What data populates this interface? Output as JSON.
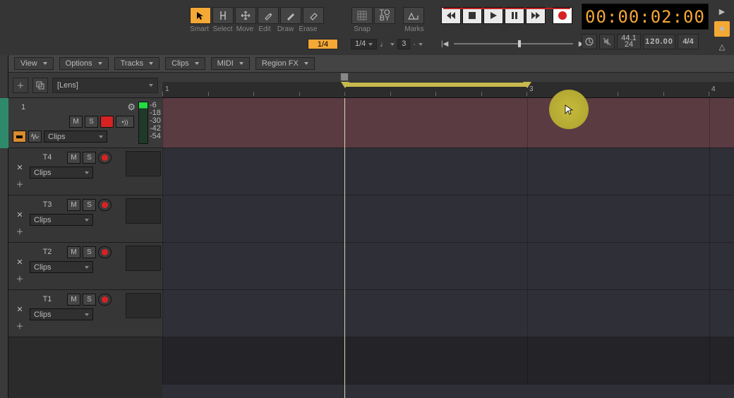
{
  "toolbar": {
    "tools": [
      "Smart",
      "Select",
      "Move",
      "Edit",
      "Draw",
      "Erase"
    ],
    "snap_label": "Snap",
    "marks_label": "Marks",
    "duration": "1/4",
    "snap_val": "1/4",
    "snap_triplet": "3"
  },
  "transport": {
    "seek_start": "|◀",
    "seek_end": "▶|"
  },
  "time": {
    "display": "00:00:02:00"
  },
  "status": {
    "sr": "44.1",
    "bits": "24",
    "bpm": "120.00",
    "ts": "4/4"
  },
  "side_expand": "▶",
  "rec_square": "■",
  "metronome": "△",
  "menus": [
    "View",
    "Options",
    "Tracks",
    "Clips",
    "MIDI",
    "Region FX"
  ],
  "panel": {
    "lens": "[Lens]"
  },
  "track1": {
    "num": "1",
    "m": "M",
    "s": "S",
    "speaker": "•))",
    "clips": "Clips",
    "meter": [
      "-6",
      "-18",
      "-30",
      "-42",
      "-54"
    ]
  },
  "subs": [
    {
      "name": "T4",
      "m": "M",
      "s": "S",
      "clips": "Clips"
    },
    {
      "name": "T3",
      "m": "M",
      "s": "S",
      "clips": "Clips"
    },
    {
      "name": "T2",
      "m": "M",
      "s": "S",
      "clips": "Clips"
    },
    {
      "name": "T1",
      "m": "M",
      "s": "S",
      "clips": "Clips"
    }
  ],
  "ruler": {
    "m1": "1",
    "m3": "3",
    "m4": "4"
  },
  "snap_grp": {
    "to": "TO",
    "by": "BY"
  }
}
